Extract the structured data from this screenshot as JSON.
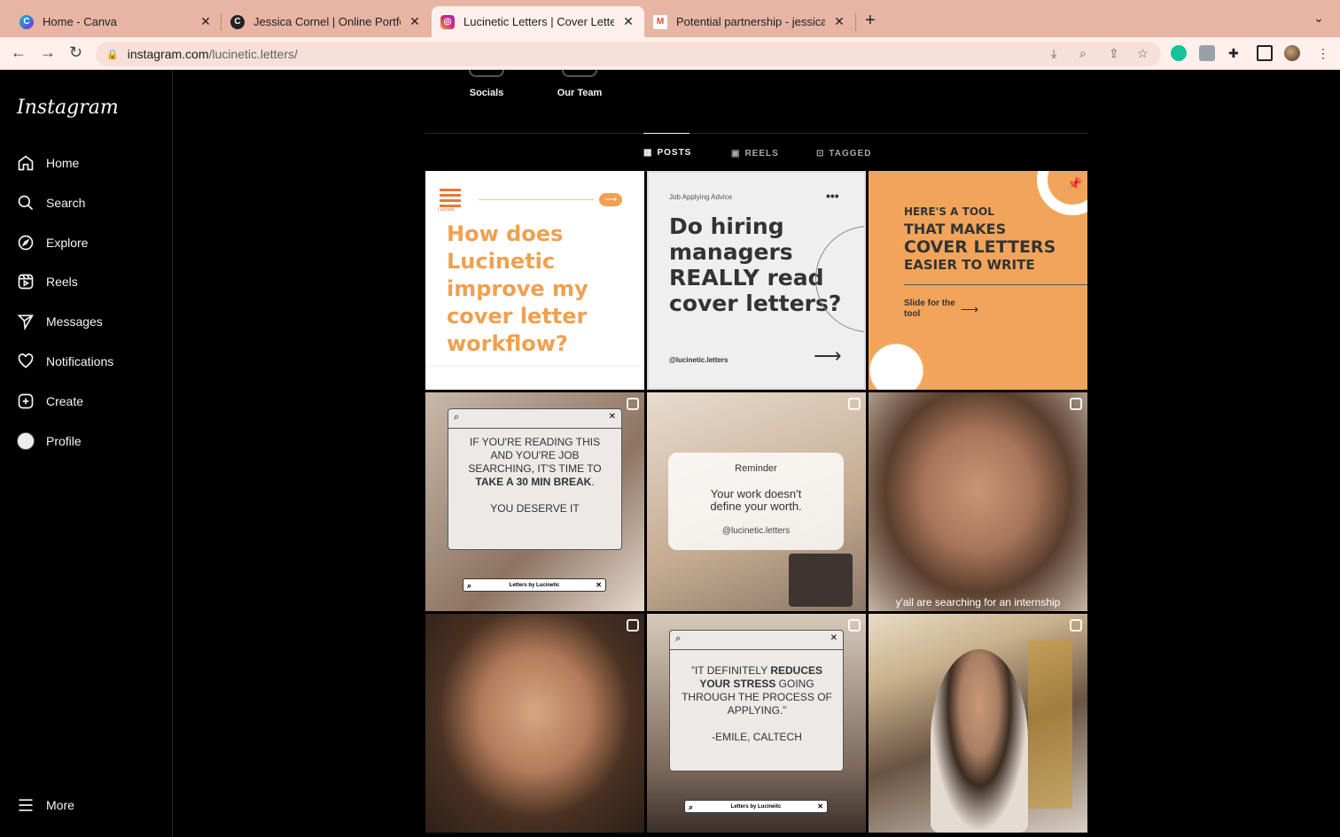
{
  "browser": {
    "tabs": [
      {
        "title": "Home - Canva",
        "favicon": "canva-icon"
      },
      {
        "title": "Jessica Cornel | Online Portfolio",
        "favicon": "portfolio-icon"
      },
      {
        "title": "Lucinetic Letters | Cover Letter",
        "favicon": "instagram-icon"
      },
      {
        "title": "Potential partnership - jessica",
        "favicon": "gmail-icon"
      }
    ],
    "url_host": "instagram.com",
    "url_path": "/lucinetic.letters/"
  },
  "sidebar": {
    "logo": "Instagram",
    "items": [
      {
        "label": "Home",
        "icon": "home-icon"
      },
      {
        "label": "Search",
        "icon": "search-icon"
      },
      {
        "label": "Explore",
        "icon": "compass-icon"
      },
      {
        "label": "Reels",
        "icon": "reels-icon"
      },
      {
        "label": "Messages",
        "icon": "send-icon"
      },
      {
        "label": "Notifications",
        "icon": "heart-icon"
      },
      {
        "label": "Create",
        "icon": "plus-square-icon"
      },
      {
        "label": "Profile",
        "icon": "avatar"
      }
    ],
    "more": "More"
  },
  "highlights": [
    {
      "label": "Socials"
    },
    {
      "label": "Our Team"
    }
  ],
  "profile_tabs": [
    {
      "label": "POSTS",
      "active": true
    },
    {
      "label": "REELS",
      "active": false
    },
    {
      "label": "TAGGED",
      "active": false
    }
  ],
  "posts": {
    "p1": {
      "title": "How does Lucinetic improve my cover letter workflow?",
      "brand": "Lucinetic"
    },
    "p2": {
      "kicker": "Job Applying Advice",
      "title": "Do hiring managers REALLY read cover letters?",
      "handle": "@lucinetic.letters"
    },
    "p3": {
      "title_lines": [
        "HERE'S A TOOL",
        "THAT MAKES",
        "COVER LETTERS",
        "EASIER TO WRITE"
      ],
      "cta": "Slide for the tool"
    },
    "p4": {
      "line1": "IF YOU'RE READING THIS AND YOU'RE JOB SEARCHING, IT'S TIME TO",
      "bold": "TAKE A 30 MIN BREAK",
      "tail": ".",
      "line2": "YOU DESERVE IT",
      "search": "Letters by Lucinetic"
    },
    "p5": {
      "kicker": "Reminder",
      "text": "Your work doesn't define your worth.",
      "handle": "@lucinetic.letters"
    },
    "p6": {
      "caption": "y'all are searching for an internship"
    },
    "p8": {
      "q1": "”IT DEFINITELY",
      "bold": "REDUCES YOUR STRESS",
      "q2": "GOING THROUGH THE PROCESS OF APPLYING.”",
      "attr": "-EMILE, CALTECH",
      "search": "Letters by Lucineitc"
    }
  },
  "colors": {
    "accent_orange": "#f0a050",
    "tab_bg": "#e8b4a4",
    "ig_bg": "#000000"
  }
}
